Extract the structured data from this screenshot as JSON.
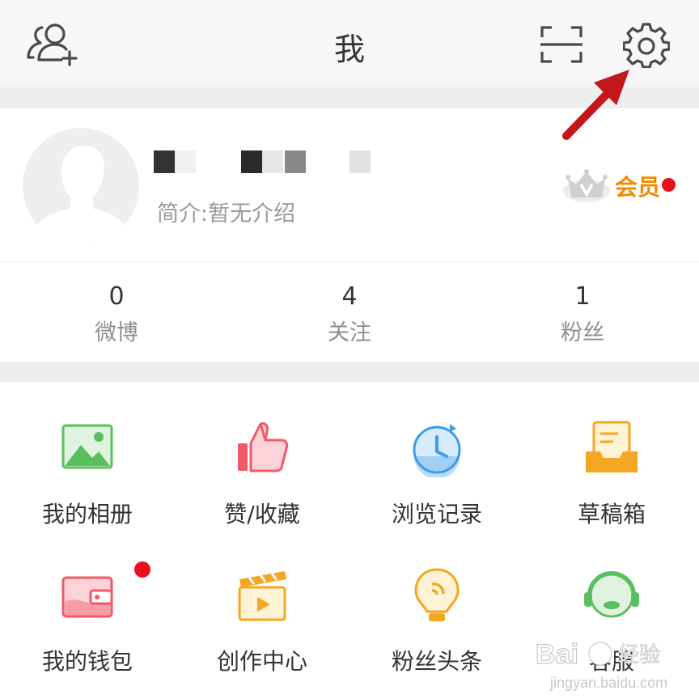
{
  "header": {
    "title": "我",
    "add_friend_icon": "add-friend-icon",
    "scan_icon": "scan-icon",
    "settings_icon": "gear-icon"
  },
  "profile": {
    "bio": "简介:暂无介绍",
    "vip_label": "会员",
    "vip_dot_color": "#e8101d",
    "vip_label_color": "#f08a00"
  },
  "stats": [
    {
      "value": "0",
      "label": "微博"
    },
    {
      "value": "4",
      "label": "关注"
    },
    {
      "value": "1",
      "label": "粉丝"
    }
  ],
  "menu": [
    {
      "label": "我的相册",
      "icon": "photo-album-icon"
    },
    {
      "label": "赞/收藏",
      "icon": "thumbs-up-icon"
    },
    {
      "label": "浏览记录",
      "icon": "history-clock-icon"
    },
    {
      "label": "草稿箱",
      "icon": "drafts-tray-icon"
    },
    {
      "label": "我的钱包",
      "icon": "wallet-icon"
    },
    {
      "label": "创作中心",
      "icon": "clapperboard-icon"
    },
    {
      "label": "粉丝头条",
      "icon": "lightbulb-icon"
    },
    {
      "label": "客服",
      "icon": "headset-icon"
    }
  ],
  "watermark": {
    "brand": "Bai",
    "brand_cn": "经验",
    "domain": "jingyan.baidu.com"
  }
}
